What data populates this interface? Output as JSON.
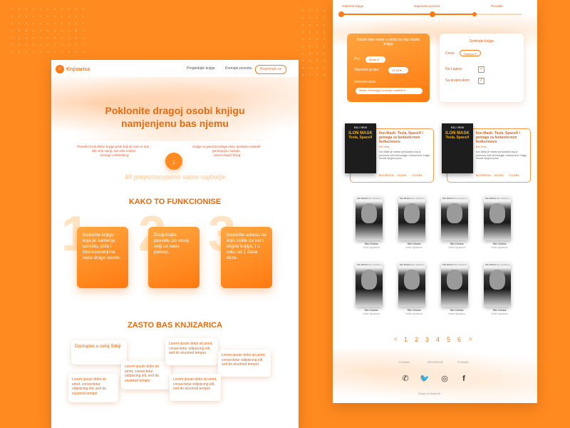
{
  "left": {
    "logo": {
      "icon": "store-icon",
      "name": "Knjizarica"
    },
    "nav": [
      "Pregledajte knjige",
      "Kreirajte posvetu"
    ],
    "register_label": "Registrujte se",
    "hero_line1": "Poklonite dragoj osobi knjigu",
    "hero_line2": "namjenjenu bas njemu",
    "quote_left": [
      "Posebni znali dobre knjige jesle bolj da nam ie one ,",
      "Sto smo stariji, sve više volimo.",
      "-George Lichtenberg"
    ],
    "quote_right": [
      "Knjige su genicina blogo oeta, dostojno naslede",
      "generacija i narodo.",
      "-Heniri David Torog"
    ],
    "down_icon": "arrow-down-icon",
    "subtitle": "Mi preporucujemo samo najbolje",
    "how_title": "KAKO TO FUNKCIONISE",
    "steps": [
      {
        "num": "1",
        "text": "Izaberite knjigu koja je namenja uzrastu, polu i interesovanjima vase drage osobe."
      },
      {
        "num": "2",
        "text": "Dizajnirajte posvetu po vasoj zelji uz nasu pomoc."
      },
      {
        "num": "3",
        "text": "Izaberite adresu na koju zelite da vam stigne knjiga, i u roku od 1 dana stize."
      }
    ],
    "why_title": "ZASTO BAS KNJIZARICA",
    "why_card_main": "Dostupno u celoj Srbiji",
    "lorem": "Lorem ipsum dolor sit amet, consectetur odipiscing elit, sed do eiusmod tempor"
  },
  "right": {
    "progress": {
      "steps": [
        "Izaberite knjigu",
        "Napravite posvetu",
        "Porudite"
      ],
      "current_step": 2
    },
    "form": {
      "title": "Recite nam nesto o osobi za koju trazite knjigu",
      "gender_label": "Pol:",
      "gender_value": "Muski",
      "age_label": "Starosna grupa:",
      "age_value": "15-18",
      "interests_label": "Interesovanja",
      "interests_value": "Nauka, Tehnologija i Inovacije i zabavne"
    },
    "sort": {
      "title": "Sortirajte knjige",
      "price_label": "Cena:",
      "price_value": "Rastuce",
      "on_stock_label": "Na Lageru",
      "on_stock_checked": true,
      "recommended_label": "Sa preporukom",
      "recommended_checked": true
    },
    "featured": [
      {
        "cover_top": "ESLI VENS",
        "cover_title": "ILON MASK",
        "cover_sub": "Tesla, SpaceX",
        "title": "Ilon Mask: Tesla, SpaceX i potraga za fantasticnom buducnoscu",
        "author": "Esli Vens",
        "desc": "Ilon Mask je hrabar preduzetnik koji je promenio svet tehnologije i buducnosti. Knjiga donosi njegovu pricu.",
        "meta": [
          "BIOGRAFIJA",
          "KNJIGA",
          "13 DANA"
        ]
      },
      {
        "cover_top": "ESLI VENS",
        "cover_title": "ILON MASK",
        "cover_sub": "Tesla, SpaceX",
        "title": "Ilon Mask: Tesla, SpaceX i potraga za fantasticnom buducnoscu",
        "author": "Esli Vens",
        "desc": "Ilon Mask je hrabar preduzetnik koji je promenio svet tehnologije i buducnosti. Knjiga donosi njegovu pricu.",
        "meta": [
          "BIOGRAFIJA",
          "KNJIGA",
          "13 DANA"
        ]
      }
    ],
    "book_grid": [
      {
        "cover_title": "Stiv Džobs",
        "cover_author": "Volter Ajzakson",
        "title": "Stiv Džobs",
        "author": "Volter Ajzakson"
      },
      {
        "cover_title": "Stiv Džobs",
        "cover_author": "Volter Ajzakson",
        "title": "Stiv Džobs",
        "author": "Volter Ajzakson"
      },
      {
        "cover_title": "Stiv Džobs",
        "cover_author": "Volter Ajzakson",
        "title": "Stiv Džobs",
        "author": "Volter Ajzakson"
      },
      {
        "cover_title": "Stiv Džobs",
        "cover_author": "Volter Ajzakson",
        "title": "Stiv Džobs",
        "author": "Volter Ajzakson"
      },
      {
        "cover_title": "Stiv Džobs",
        "cover_author": "Volter Ajzakson",
        "title": "Stiv Džobs",
        "author": "Volter Ajzakson"
      },
      {
        "cover_title": "Stiv Džobs",
        "cover_author": "Volter Ajzakson",
        "title": "Stiv Džobs",
        "author": "Volter Ajzakson"
      },
      {
        "cover_title": "Stiv Džobs",
        "cover_author": "Volter Ajzakson",
        "title": "Stiv Džobs",
        "author": "Volter Ajzakson"
      },
      {
        "cover_title": "Stiv Džobs",
        "cover_author": "Volter Ajzakson",
        "title": "Stiv Džobs",
        "author": "Volter Ajzakson"
      }
    ],
    "pagination": {
      "prev": "<",
      "pages": [
        "1",
        "2",
        "3",
        "4",
        "5",
        "6"
      ],
      "next": ">"
    },
    "footer": {
      "links": [
        "O NAMA",
        "RECENZIJE",
        "O NAMA"
      ],
      "social": [
        "whatsapp-icon",
        "twitter-icon",
        "instagram-icon",
        "facebook-icon"
      ],
      "credit": "Design by Marija Ilic"
    }
  },
  "colors": {
    "accent": "#ff7a14",
    "background": "#ff8a1f"
  }
}
